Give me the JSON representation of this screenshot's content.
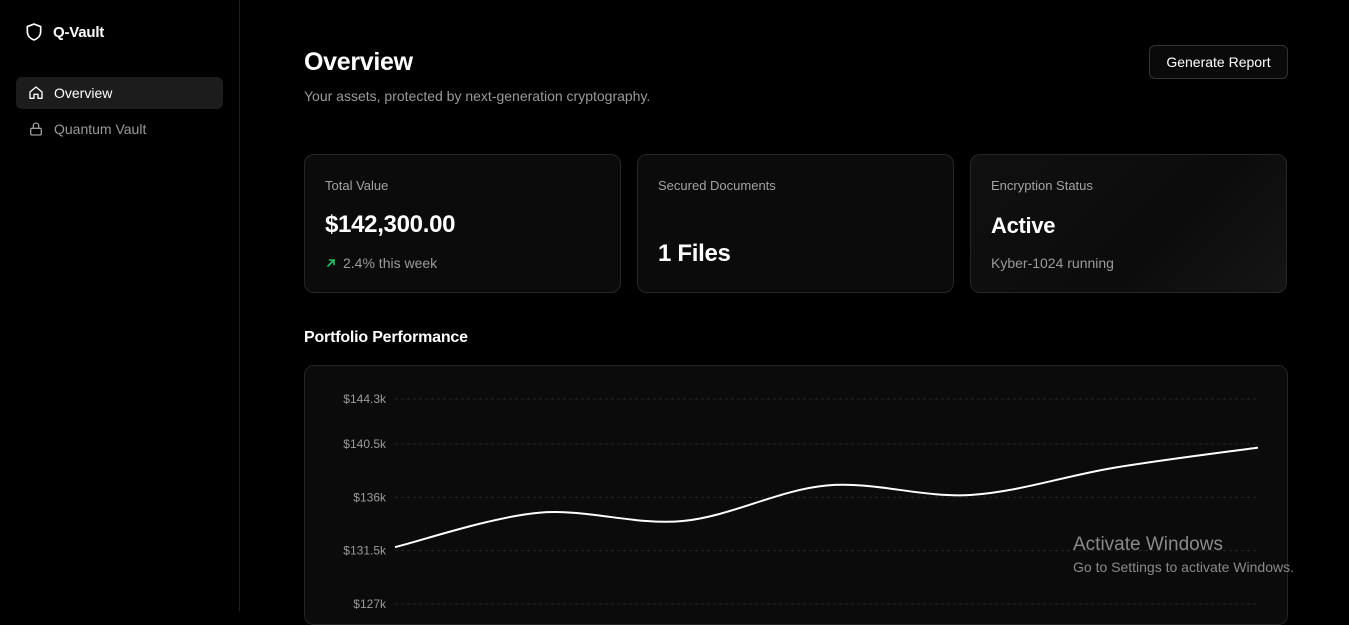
{
  "app": {
    "name": "Q-Vault"
  },
  "sidebar": {
    "items": [
      {
        "label": "Overview",
        "icon": "home-icon",
        "active": true
      },
      {
        "label": "Quantum Vault",
        "icon": "lock-icon",
        "active": false
      }
    ]
  },
  "header": {
    "title": "Overview",
    "subtitle": "Your assets, protected by next-generation cryptography.",
    "report_button": "Generate Report"
  },
  "cards": [
    {
      "label": "Total Value",
      "value": "$142,300.00",
      "sub": "2.4% this week",
      "sub_icon": "arrow-up-right-icon",
      "sub_color": "#22c55e"
    },
    {
      "label": "Secured Documents",
      "value": "1 Files"
    },
    {
      "label": "Encryption Status",
      "value": "Active",
      "sub": "Kyber-1024 running"
    }
  ],
  "performance": {
    "title": "Portfolio Performance"
  },
  "chart_data": {
    "type": "line",
    "y_ticks": [
      "$144.3k",
      "$140.5k",
      "$136k",
      "$131.5k",
      "$127k"
    ],
    "y_tick_values": [
      144300,
      140500,
      136000,
      131500,
      127000
    ],
    "ylim": [
      127000,
      144300
    ],
    "grid": true,
    "series": [
      {
        "values": [
          131800,
          134700,
          134000,
          137000,
          136200,
          138500,
          140200
        ]
      }
    ]
  },
  "watermark": {
    "line1": "Activate Windows",
    "line2": "Go to Settings to activate Windows."
  }
}
